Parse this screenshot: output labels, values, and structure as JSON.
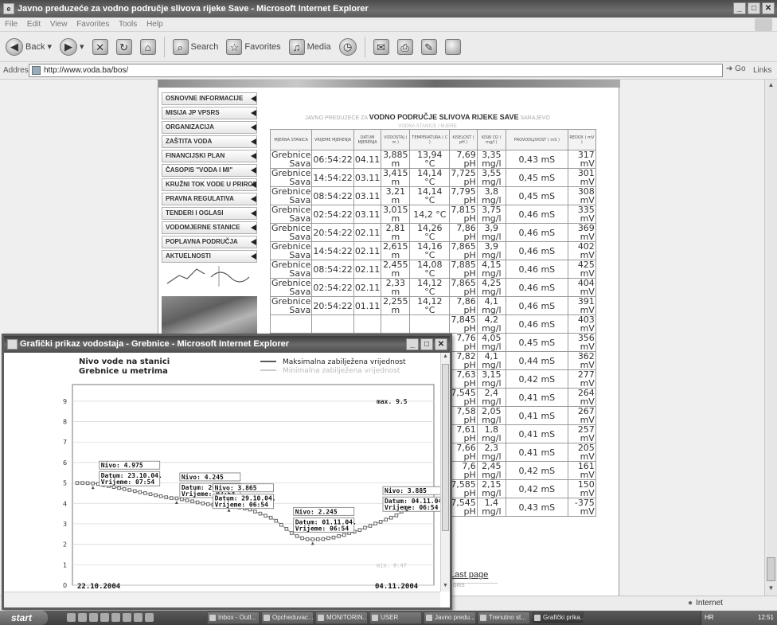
{
  "main_window": {
    "title": "Javno preduzeće za vodno područje slivova rijeke Save - Microsoft Internet Explorer",
    "menu": [
      "File",
      "Edit",
      "View",
      "Favorites",
      "Tools",
      "Help"
    ],
    "toolbar": {
      "back": "Back",
      "search": "Search",
      "favorites": "Favorites",
      "media": "Media"
    },
    "address_label": "Address",
    "address_url": "http://www.voda.ba/bos/",
    "go_label": "Go",
    "links_label": "Links",
    "status_zone": "Internet"
  },
  "site": {
    "nav_items": [
      "OSNOVNE INFORMACIJE",
      "MISIJA JP VPSRS",
      "ORGANIZACIJA",
      "ZAŠTITA VODA",
      "FINANCIJSKI PLAN",
      "ČASOPIS \"VODA I MI\"",
      "KRUŽNI TOK VODE U PRIRODI",
      "PRAVNA REGULATIVA",
      "TENDERI I OGLASI",
      "VODOMJERNE STANICE",
      "POPLAVNA PODRUČJA",
      "AKTUELNOSTI"
    ],
    "heading_prefix": "JAVNO PREDUZEĆE ZA",
    "heading_main": "VODNO PODRUČJE SLIVOVA RIJEKE SAVE",
    "heading_suffix": "SARAJEVO",
    "heading_sub": "VODNA STANICE I MJERE",
    "table_headers": [
      "MJERNA STANICA",
      "VRIJEME MJERENJA",
      "DATUM MJERENJA",
      "VODOSTAJ ( m )",
      "TEMPERATURA ( C )",
      "KISELOST ( pH )",
      "KISIK O2 ( mg/l )",
      "PROVODLJIVOST ( mS )",
      "REDOX ( mV )"
    ],
    "rows": [
      {
        "station": "Grebnice Sava",
        "time": "06:54:22",
        "date": "04.11",
        "level": "3,885 m",
        "temp": "13,94 °C",
        "ph": "7,69 pH",
        "o2": "3,35 mg/l",
        "cond": "0,43 mS",
        "redox": "317 mV"
      },
      {
        "station": "Grebnice Sava",
        "time": "14:54:22",
        "date": "03.11",
        "level": "3,415 m",
        "temp": "14,14 °C",
        "ph": "7,725 pH",
        "o2": "3,55 mg/l",
        "cond": "0,45 mS",
        "redox": "301 mV"
      },
      {
        "station": "Grebnice Sava",
        "time": "08:54:22",
        "date": "03.11",
        "level": "3,21 m",
        "temp": "14,14 °C",
        "ph": "7,795 pH",
        "o2": "3,8 mg/l",
        "cond": "0,45 mS",
        "redox": "308 mV"
      },
      {
        "station": "Grebnice Sava",
        "time": "02:54:22",
        "date": "03.11",
        "level": "3,015 m",
        "temp": "14,2 °C",
        "ph": "7,815 pH",
        "o2": "3,75 mg/l",
        "cond": "0,46 mS",
        "redox": "335 mV"
      },
      {
        "station": "Grebnice Sava",
        "time": "20:54:22",
        "date": "02.11",
        "level": "2,81 m",
        "temp": "14,26 °C",
        "ph": "7,86 pH",
        "o2": "3,9 mg/l",
        "cond": "0,46 mS",
        "redox": "369 mV"
      },
      {
        "station": "Grebnice Sava",
        "time": "14:54:22",
        "date": "02.11",
        "level": "2,615 m",
        "temp": "14,16 °C",
        "ph": "7,865 pH",
        "o2": "3,9 mg/l",
        "cond": "0,46 mS",
        "redox": "402 mV"
      },
      {
        "station": "Grebnice Sava",
        "time": "08:54:22",
        "date": "02.11",
        "level": "2,455 m",
        "temp": "14,08 °C",
        "ph": "7,885 pH",
        "o2": "4,15 mg/l",
        "cond": "0,46 mS",
        "redox": "425 mV"
      },
      {
        "station": "Grebnice Sava",
        "time": "02:54:22",
        "date": "02.11",
        "level": "2,33 m",
        "temp": "14,12 °C",
        "ph": "7,865 pH",
        "o2": "4,25 mg/l",
        "cond": "0,46 mS",
        "redox": "404 mV"
      },
      {
        "station": "Grebnice Sava",
        "time": "20:54:22",
        "date": "01.11",
        "level": "2,255 m",
        "temp": "14,12 °C",
        "ph": "7,86 pH",
        "o2": "4,1 mg/l",
        "cond": "0,46 mS",
        "redox": "391 mV"
      },
      {
        "station": "",
        "time": "",
        "date": "",
        "level": "",
        "temp": "",
        "ph": "7,845 pH",
        "o2": "4,2 mg/l",
        "cond": "0,46 mS",
        "redox": "403 mV"
      },
      {
        "station": "",
        "time": "",
        "date": "",
        "level": "",
        "temp": "",
        "ph": "7,76 pH",
        "o2": "4,05 mg/l",
        "cond": "0,45 mS",
        "redox": "356 mV"
      },
      {
        "station": "",
        "time": "",
        "date": "",
        "level": "",
        "temp": "",
        "ph": "7,82 pH",
        "o2": "4,1 mg/l",
        "cond": "0,44 mS",
        "redox": "362 mV"
      },
      {
        "station": "",
        "time": "",
        "date": "",
        "level": "",
        "temp": "",
        "ph": "7,63 pH",
        "o2": "3,15 mg/l",
        "cond": "0,42 mS",
        "redox": "277 mV"
      },
      {
        "station": "",
        "time": "",
        "date": "",
        "level": "",
        "temp": "",
        "ph": "7,545 pH",
        "o2": "2,4 mg/l",
        "cond": "0,41 mS",
        "redox": "264 mV"
      },
      {
        "station": "",
        "time": "",
        "date": "",
        "level": "",
        "temp": "",
        "ph": "7,58 pH",
        "o2": "2,05 mg/l",
        "cond": "0,41 mS",
        "redox": "267 mV"
      },
      {
        "station": "",
        "time": "",
        "date": "",
        "level": "",
        "temp": "",
        "ph": "7,61 pH",
        "o2": "1,8 mg/l",
        "cond": "0,41 mS",
        "redox": "257 mV"
      },
      {
        "station": "",
        "time": "",
        "date": "",
        "level": "",
        "temp": "",
        "ph": "7,66 pH",
        "o2": "2,3 mg/l",
        "cond": "0,41 mS",
        "redox": "205 mV"
      },
      {
        "station": "",
        "time": "",
        "date": "",
        "level": "",
        "temp": "",
        "ph": "7,6 pH",
        "o2": "2,45 mg/l",
        "cond": "0,42 mS",
        "redox": "161 mV"
      },
      {
        "station": "",
        "time": "",
        "date": "",
        "level": "",
        "temp": "",
        "ph": "7,585 pH",
        "o2": "2,15 mg/l",
        "cond": "0,42 mS",
        "redox": "150 mV"
      },
      {
        "station": "",
        "time": "",
        "date": "",
        "level": "",
        "temp": "",
        "ph": "7,545 pH",
        "o2": "1,4 mg/l",
        "cond": "0,43 mS",
        "redox": "-375 mV"
      }
    ],
    "last_page": "Last page",
    "footer_logo": "GRIS"
  },
  "popup": {
    "title": "Grafički prikaz vodostaja - Grebnice - Microsoft Internet Explorer"
  },
  "chart_data": {
    "type": "line",
    "title": [
      "Nivo vode na stanici",
      "Grebnice u metrima"
    ],
    "legend": [
      {
        "label": "Maksimalna zabilježena vrijednost",
        "color": "#222222"
      },
      {
        "label": "Minimalna zabilježena vrijednost",
        "color": "#bbbbbb"
      }
    ],
    "ylim": [
      0,
      9.5
    ],
    "yticks": [
      0,
      1,
      2,
      3,
      4,
      5,
      6,
      7,
      8,
      9
    ],
    "max_label": "max. 9.5",
    "min_label": "min. 0.47",
    "x_start_label": "22.10.2004",
    "x_end_label": "04.11.2004",
    "series": [
      {
        "values": [
          5.0,
          5.0,
          4.99,
          4.975,
          4.95,
          4.9,
          4.85,
          4.8,
          4.75,
          4.7,
          4.65,
          4.6,
          4.55,
          4.5,
          4.45,
          4.4,
          4.35,
          4.3,
          4.26,
          4.245,
          4.2,
          4.15,
          4.1,
          4.05,
          4.0,
          3.96,
          3.93,
          3.9,
          3.88,
          3.865,
          3.84,
          3.8,
          3.75,
          3.7,
          3.6,
          3.5,
          3.4,
          3.3,
          3.15,
          2.95,
          2.75,
          2.55,
          2.4,
          2.3,
          2.25,
          2.245,
          2.25,
          2.255,
          2.3,
          2.33,
          2.4,
          2.455,
          2.55,
          2.615,
          2.7,
          2.81,
          2.9,
          3.015,
          3.1,
          3.21,
          3.3,
          3.415,
          3.6,
          3.885
        ]
      }
    ],
    "annotations": [
      {
        "index": 3,
        "nivo": "Nivo: 4.975",
        "datum": "Datum: 23.10.04.",
        "vrijeme": "Vrijeme: 07:54"
      },
      {
        "index": 19,
        "nivo": "Nivo: 4.245",
        "datum": "Datum: 26.10.04.",
        "vrijeme": "Vrijeme: 07:54"
      },
      {
        "index": 29,
        "nivo": "Nivo: 3.865",
        "datum": "Datum: 29.10.04.",
        "vrijeme": "Vrijeme: 06:54"
      },
      {
        "index": 45,
        "nivo": "Nivo: 2.245",
        "datum": "Datum: 01.11.04.",
        "vrijeme": "Vrijeme: 06:54"
      },
      {
        "index": 63,
        "nivo": "Nivo: 3.885",
        "datum": "Datum: 04.11.04.",
        "vrijeme": "Vrijeme: 06:54"
      }
    ]
  },
  "taskbar": {
    "start": "start",
    "tasks": [
      "Inbox - Outl...",
      "Opcheduvac...",
      "MONITORIN...",
      "USER",
      "Javno predu...",
      "Trenutno st...",
      "Grafički prika..."
    ],
    "tray_lang": "HR",
    "clock": "12:51"
  }
}
